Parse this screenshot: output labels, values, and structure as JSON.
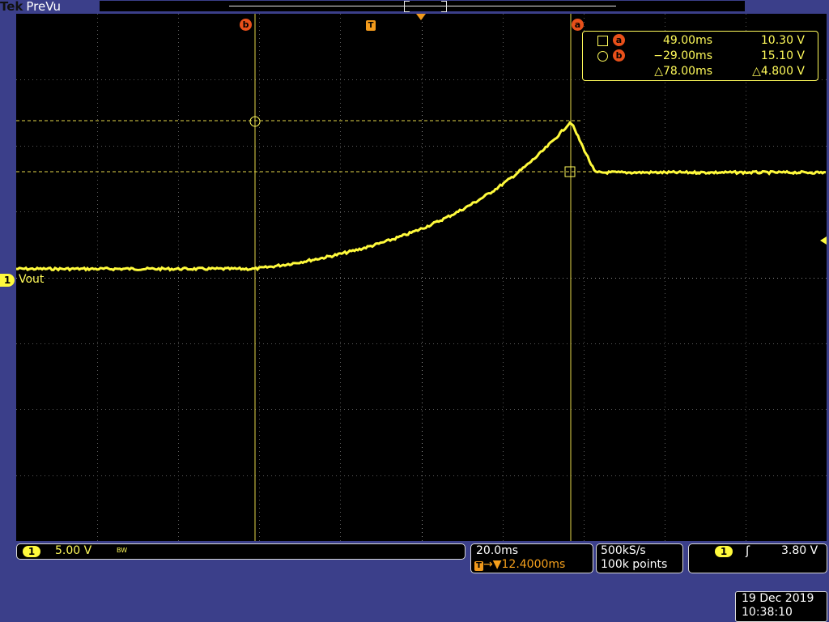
{
  "brand": {
    "name": "Tek",
    "mode": "PreVu"
  },
  "channel": {
    "number": "1",
    "label": "Vout",
    "scale": "5.00 V",
    "bw_indicator": "BW"
  },
  "cursors": {
    "a": {
      "marker": "a",
      "time": "49.00ms",
      "voltage": "10.30 V"
    },
    "b": {
      "marker": "b",
      "time": "−29.00ms",
      "voltage": "15.10 V"
    },
    "delta": {
      "time": "△78.00ms",
      "voltage": "△4.800 V"
    }
  },
  "trigger_marker": "T",
  "timebase": {
    "scale": "20.0ms",
    "position": "▼12.4000ms",
    "arrow": "→"
  },
  "acquisition": {
    "sample_rate": "500kS/s",
    "record_length": "100k points"
  },
  "trigger": {
    "source": "1",
    "slope_icon": "rising-edge-icon",
    "slope_glyph": "ʃ",
    "level": "3.80 V"
  },
  "datetime": {
    "date": "19 Dec 2019",
    "time": "10:38:10"
  },
  "colors": {
    "trace": "#fffa3c",
    "cursor_marker": "#e8501a",
    "trigger": "#f29a1c",
    "background": "#3b3f8a"
  }
}
